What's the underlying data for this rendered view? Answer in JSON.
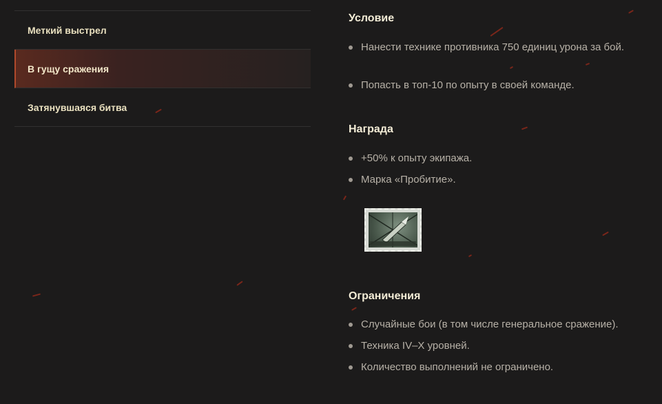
{
  "sidebar": {
    "items": [
      {
        "label": "Меткий выстрел"
      },
      {
        "label": "В гущу сражения"
      },
      {
        "label": "Затянувшаяся битва"
      }
    ],
    "active_index": 1
  },
  "sections": {
    "condition": {
      "title": "Условие",
      "items": [
        "Нанести технике противника 750 единиц урона за бой.",
        "Попасть в топ-10 по опыту в своей команде."
      ]
    },
    "reward": {
      "title": "Награда",
      "items": [
        "+50% к опыту экипажа.",
        "Марка «Пробитие»."
      ],
      "stamp_icon": "penetration-stamp-icon"
    },
    "restrictions": {
      "title": "Ограничения",
      "items": [
        "Случайные бои (в том числе генеральное сражение).",
        "Техника IV–X уровней.",
        "Количество выполнений не ограничено."
      ]
    }
  },
  "colors": {
    "background": "#1c1b1b",
    "accent": "#b04a2c",
    "title": "#f3ecd6",
    "text": "#b7b1a7"
  }
}
